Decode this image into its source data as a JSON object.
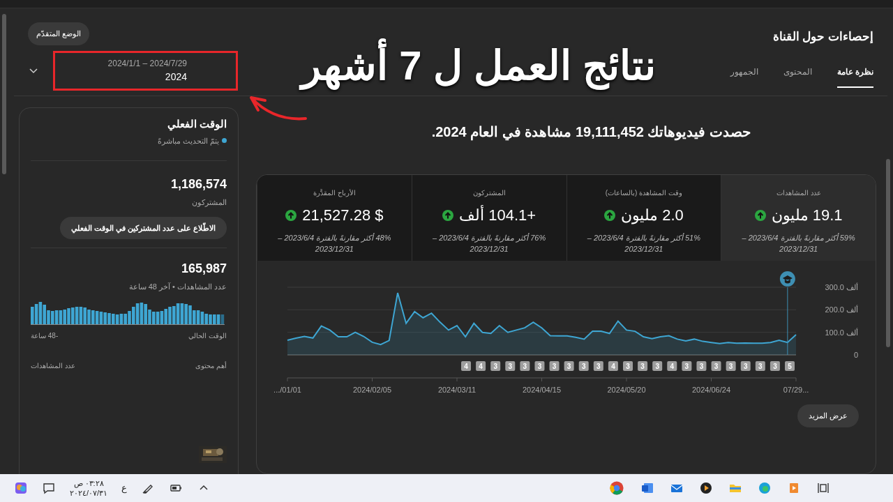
{
  "overlay": {
    "headline": "نتائج العمل ل 7 أشهر"
  },
  "advanced_button": "الوضع المتقدّم",
  "date_picker": {
    "range": "2024/1/1 – 2024/7/29",
    "value": "2024"
  },
  "header": {
    "title": "إحصاءات حول القناة"
  },
  "tabs": [
    {
      "label": "نظرة عامة",
      "selected": true
    },
    {
      "label": "المحتوى",
      "selected": false
    },
    {
      "label": "الجمهور",
      "selected": false
    }
  ],
  "realtime": {
    "title": "الوقت الفعلي",
    "live_note": "يتمّ التحديث مباشرةً",
    "subscribers": "1,186,574",
    "subscribers_label": "المشتركون",
    "live_button": "الاطّلاع على عدد المشتركين في الوقت الفعلي",
    "views": "165,987",
    "views_label": "عدد المشاهدات • آخر 48 ساعة",
    "axis_start": "الوقت الحالي",
    "axis_end": "-48 ساعة",
    "top_content_label": "أهم محتوى",
    "top_views_label": "عدد المشاهدات"
  },
  "summary": "حصدت فيديوهاتك **19,111,452** مشاهدة في العام **2024.**",
  "metrics": [
    {
      "label": "عدد المشاهدات",
      "value": "19.1 مليون",
      "up": true,
      "selected": true,
      "comparison": "59% أكثر مقارنةً بالفترة 2023/6/4 – 2023/12/31"
    },
    {
      "label": "وقت المشاهدة (بالساعات)",
      "value": "2.0 مليون",
      "up": true,
      "selected": false,
      "comparison": "51% أكثر مقارنةً بالفترة 2023/6/4 – 2023/12/31"
    },
    {
      "label": "المشتركون",
      "value": "+104.1 ألف",
      "up": true,
      "selected": false,
      "comparison": "76% أكثر مقارنةً بالفترة 2023/6/4 – 2023/12/31"
    },
    {
      "label": "الأرباح المقدَّرة",
      "value": "$ 21,527.28",
      "up": true,
      "selected": false,
      "comparison": "48% أكثر مقارنةً بالفترة 2023/6/4 – 2023/12/31"
    }
  ],
  "chart_data": {
    "type": "area",
    "categories": [
      ".../01/01",
      null,
      null,
      null,
      null,
      null,
      null,
      null,
      null,
      null,
      "2024/02/05",
      null,
      null,
      null,
      null,
      null,
      null,
      null,
      null,
      null,
      "2024/03/11",
      null,
      null,
      null,
      null,
      null,
      null,
      null,
      null,
      null,
      "2024/04/15",
      null,
      null,
      null,
      null,
      null,
      null,
      null,
      null,
      null,
      "2024/05/20",
      null,
      null,
      null,
      null,
      null,
      null,
      null,
      null,
      null,
      "2024/06/24",
      null,
      null,
      null,
      null,
      null,
      null,
      null,
      null,
      null,
      "07/29..."
    ],
    "series": [
      {
        "color": "#3ea6d3",
        "values": [
          65,
          74,
          82,
          75,
          128,
          110,
          80,
          80,
          100,
          82,
          56,
          46,
          64,
          275,
          140,
          192,
          165,
          185,
          145,
          110,
          130,
          80,
          140,
          100,
          95,
          130,
          100,
          110,
          120,
          145,
          120,
          85,
          84,
          84,
          78,
          70,
          105,
          105,
          95,
          150,
          110,
          105,
          80,
          72,
          80,
          85,
          70,
          62,
          70,
          60,
          55,
          50,
          55,
          52,
          53,
          52,
          52,
          55,
          65,
          55,
          90
        ]
      }
    ],
    "ylim": [
      0,
      300
    ],
    "yticks": [
      {
        "value": 0,
        "label": "0"
      },
      {
        "value": 100,
        "label": "100.0 ألف"
      },
      {
        "value": 200,
        "label": "200.0 ألف"
      },
      {
        "value": 300,
        "label": "300.0 ألف"
      }
    ]
  },
  "upload_badges": [
    "5",
    "3",
    "3",
    "3",
    "3",
    "3",
    "3",
    "3",
    "4",
    "3",
    "3",
    "3",
    "4",
    "3",
    "3",
    "3",
    "3",
    "3",
    "3",
    "3",
    "3",
    "4",
    "4"
  ],
  "more_button": "عرض المزيد",
  "taskbar": {
    "time": "٠٣:٢٨ ص",
    "date": "٢٠٢٤/٠٧/٣١",
    "language": "ع"
  }
}
